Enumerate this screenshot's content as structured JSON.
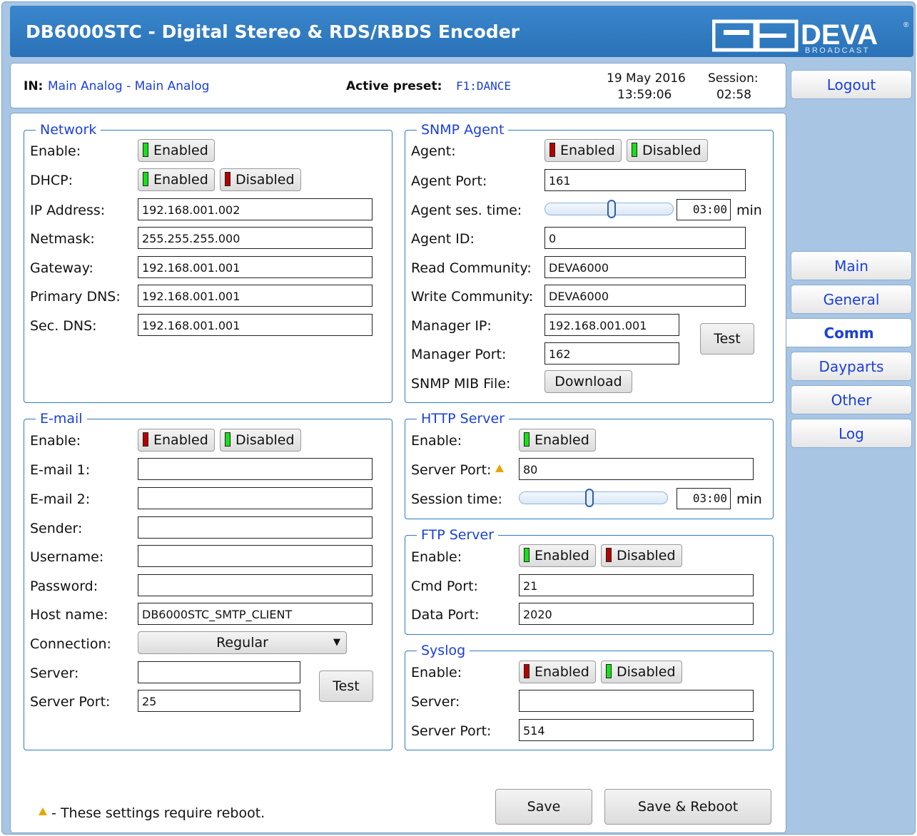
{
  "header": {
    "title": "DB6000STC - Digital Stereo & RDS/RBDS Encoder",
    "logo_text": "DEVA",
    "logo_sub": "BROADCAST"
  },
  "info": {
    "in_label": "IN:",
    "in_value": "Main Analog - Main Analog",
    "preset_label": "Active preset:",
    "preset_value": "F1:DANCE",
    "date": "19 May 2016",
    "time": "13:59:06",
    "session_label": "Session:",
    "session_value": "02:58"
  },
  "sidebar": {
    "logout": "Logout",
    "items": [
      {
        "label": "Main"
      },
      {
        "label": "General"
      },
      {
        "label": "Comm"
      },
      {
        "label": "Dayparts"
      },
      {
        "label": "Other"
      },
      {
        "label": "Log"
      }
    ],
    "active": "Comm"
  },
  "network": {
    "title": "Network",
    "enable_label": "Enable:",
    "enable_btn": "Enabled",
    "dhcp_label": "DHCP:",
    "dhcp_enabled": "Enabled",
    "dhcp_disabled": "Disabled",
    "ip_label": "IP Address:",
    "ip": "192.168.001.002",
    "netmask_label": "Netmask:",
    "netmask": "255.255.255.000",
    "gateway_label": "Gateway:",
    "gateway": "192.168.001.001",
    "pdns_label": "Primary DNS:",
    "pdns": "192.168.001.001",
    "sdns_label": "Sec. DNS:",
    "sdns": "192.168.001.001"
  },
  "email": {
    "title": "E-mail",
    "enable_label": "Enable:",
    "enabled": "Enabled",
    "disabled": "Disabled",
    "email1_label": "E-mail 1:",
    "email1": "",
    "email2_label": "E-mail 2:",
    "email2": "",
    "sender_label": "Sender:",
    "sender": "",
    "username_label": "Username:",
    "username": "",
    "password_label": "Password:",
    "password": "",
    "host_label": "Host name:",
    "host": "DB6000STC_SMTP_CLIENT",
    "connection_label": "Connection:",
    "connection": "Regular",
    "server_label": "Server:",
    "server": "",
    "port_label": "Server Port:",
    "port": "25",
    "test": "Test"
  },
  "snmp": {
    "title": "SNMP Agent",
    "agent_label": "Agent:",
    "enabled": "Enabled",
    "disabled": "Disabled",
    "port_label": "Agent Port:",
    "port": "161",
    "ses_label": "Agent ses. time:",
    "ses_time": "03:00",
    "ses_unit": "min",
    "ses_level": 0.52,
    "id_label": "Agent ID:",
    "id": "0",
    "read_label": "Read Community:",
    "read": "DEVA6000",
    "write_label": "Write Community:",
    "write": "DEVA6000",
    "mgr_ip_label": "Manager IP:",
    "mgr_ip": "192.168.001.001",
    "mgr_port_label": "Manager Port:",
    "mgr_port": "162",
    "mib_label": "SNMP MIB File:",
    "download": "Download",
    "test": "Test"
  },
  "http": {
    "title": "HTTP Server",
    "enable_label": "Enable:",
    "enabled": "Enabled",
    "port_label": "Server Port:",
    "port": "80",
    "session_label": "Session time:",
    "session": "03:00",
    "unit": "min",
    "level": 0.47
  },
  "ftp": {
    "title": "FTP Server",
    "enable_label": "Enable:",
    "enabled": "Enabled",
    "disabled": "Disabled",
    "cmd_label": "Cmd Port:",
    "cmd": "21",
    "data_label": "Data Port:",
    "data": "2020"
  },
  "syslog": {
    "title": "Syslog",
    "enable_label": "Enable:",
    "enabled": "Enabled",
    "disabled": "Disabled",
    "server_label": "Server:",
    "server": "",
    "port_label": "Server Port:",
    "port": "514"
  },
  "footer": {
    "note": "- These settings require reboot.",
    "save": "Save",
    "save_reboot": "Save & Reboot"
  },
  "colors": {
    "header": "#2f7bc2",
    "link": "#1a3fdc",
    "led_on": "#18e018",
    "led_off": "#b80000"
  }
}
